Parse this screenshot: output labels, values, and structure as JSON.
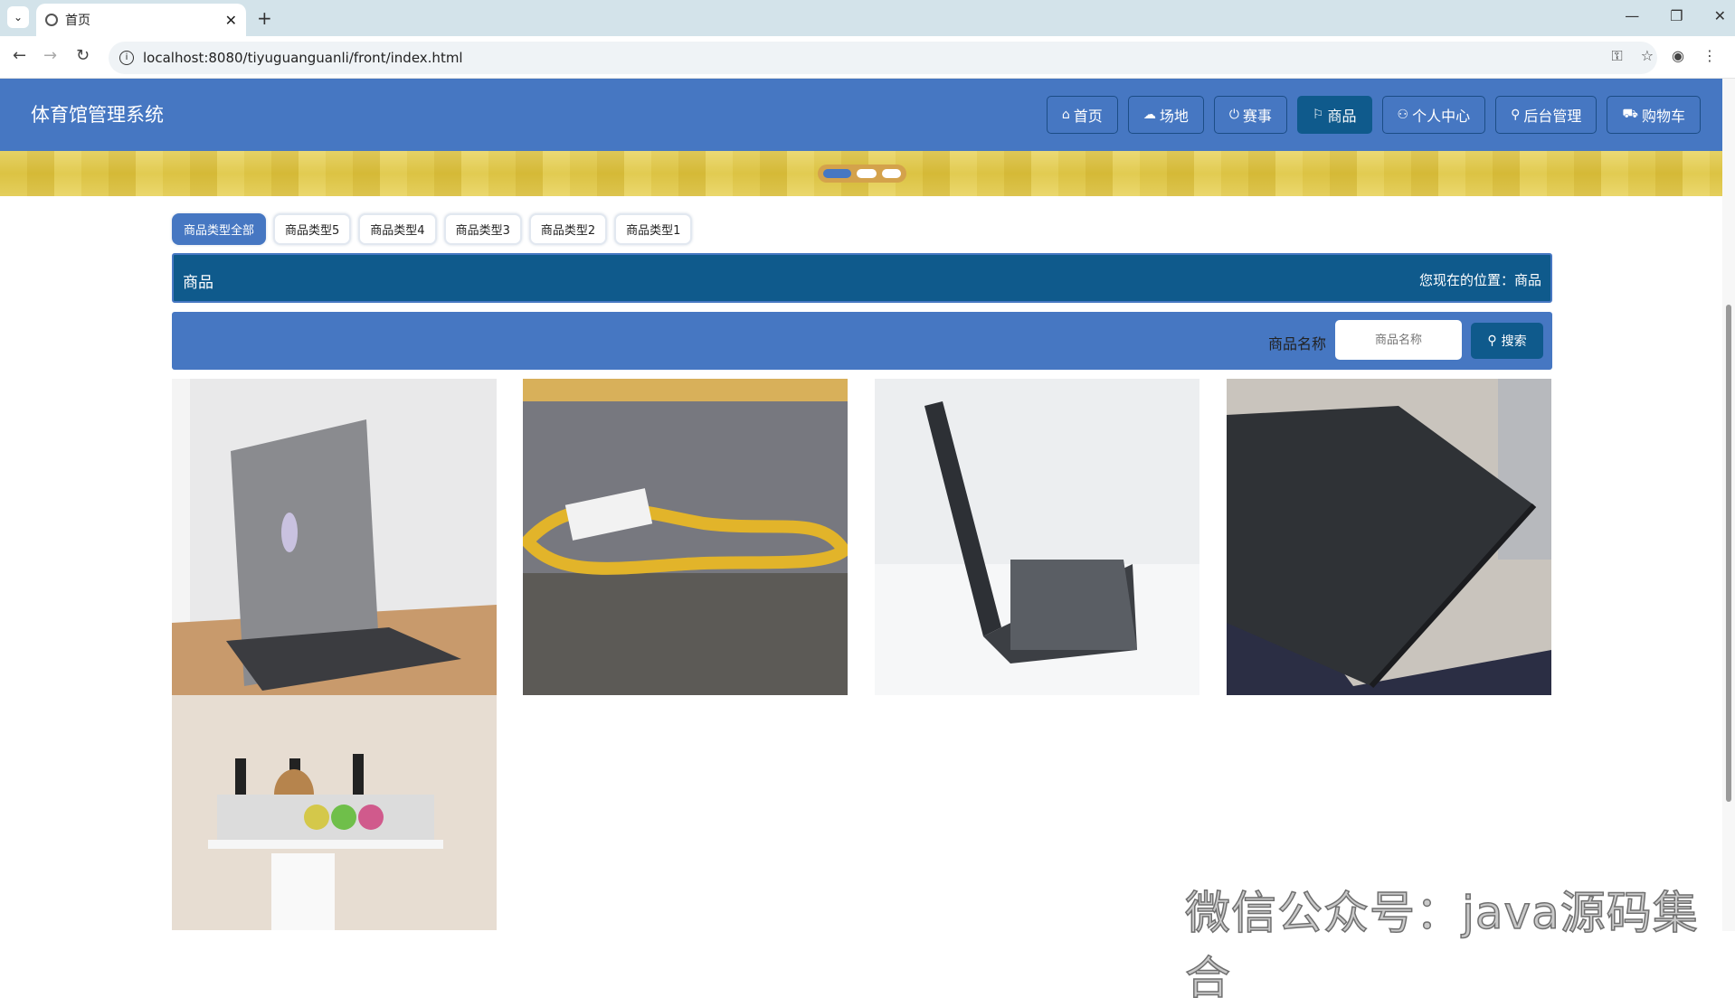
{
  "browser": {
    "tab_title": "首页",
    "url": "localhost:8080/tiyuguanguanli/front/index.html"
  },
  "header": {
    "site_title": "体育馆管理系统",
    "nav": [
      {
        "label": "首页",
        "icon": "home-icon"
      },
      {
        "label": "场地",
        "icon": "cloud-icon"
      },
      {
        "label": "赛事",
        "icon": "power-icon"
      },
      {
        "label": "商品",
        "icon": "flag-icon"
      },
      {
        "label": "个人中心",
        "icon": "user-icon"
      },
      {
        "label": "后台管理",
        "icon": "link-icon"
      },
      {
        "label": "购物车",
        "icon": "cart-icon"
      }
    ],
    "active_nav": "商品"
  },
  "categories": [
    "商品类型全部",
    "商品类型5",
    "商品类型4",
    "商品类型3",
    "商品类型2",
    "商品类型1"
  ],
  "section": {
    "title": "商品",
    "breadcrumb": "您现在的位置：商品"
  },
  "search": {
    "label": "商品名称",
    "placeholder": "商品名称",
    "button": "搜索"
  },
  "products": [
    {
      "image": "gray-laptop-back-photo"
    },
    {
      "image": "gold-chain-necklace-photo"
    },
    {
      "image": "black-laptop-side-photo"
    },
    {
      "image": "dark-laptop-lid-photo"
    },
    {
      "image": "kitchen-knife-rack-photo"
    }
  ],
  "watermark": "微信公众号：java源码集合",
  "colors": {
    "primary": "#4677c2",
    "dark": "#0f5a8c"
  }
}
